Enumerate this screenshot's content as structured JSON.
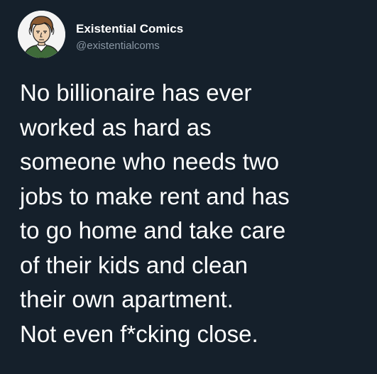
{
  "author": {
    "display_name": "Existential Comics",
    "handle": "@existentialcoms",
    "avatar_icon": "cartoon-portrait-avatar"
  },
  "tweet": {
    "lines": [
      "No billionaire has ever",
      "worked as hard as",
      "someone who needs two",
      "jobs to make rent and has",
      "to go home and take care",
      "of their kids and clean",
      "their own apartment.",
      "Not even f*cking close."
    ]
  },
  "colors": {
    "background": "#15202b",
    "text": "#ffffff",
    "secondary_text": "#8b98a5"
  }
}
